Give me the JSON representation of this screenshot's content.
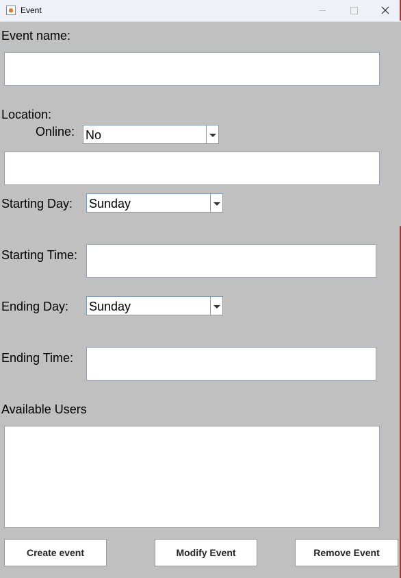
{
  "window": {
    "title": "Event"
  },
  "labels": {
    "event_name": "Event name:",
    "location": "Location:",
    "online": "Online:",
    "starting_day": "Starting Day:",
    "starting_time": "Starting Time:",
    "ending_day": "Ending Day:",
    "ending_time": "Ending Time:",
    "available_users": "Available Users"
  },
  "fields": {
    "event_name": "",
    "location": "",
    "starting_time": "",
    "ending_time": "",
    "available_users": ""
  },
  "selects": {
    "online": "No",
    "starting_day": "Sunday",
    "ending_day": "Sunday"
  },
  "buttons": {
    "create": "Create event",
    "modify": "Modify Event",
    "remove": "Remove Event"
  },
  "icons": {
    "app": "java-app-icon",
    "minimize": "minimize-icon",
    "maximize": "maximize-icon",
    "close": "close-icon"
  }
}
